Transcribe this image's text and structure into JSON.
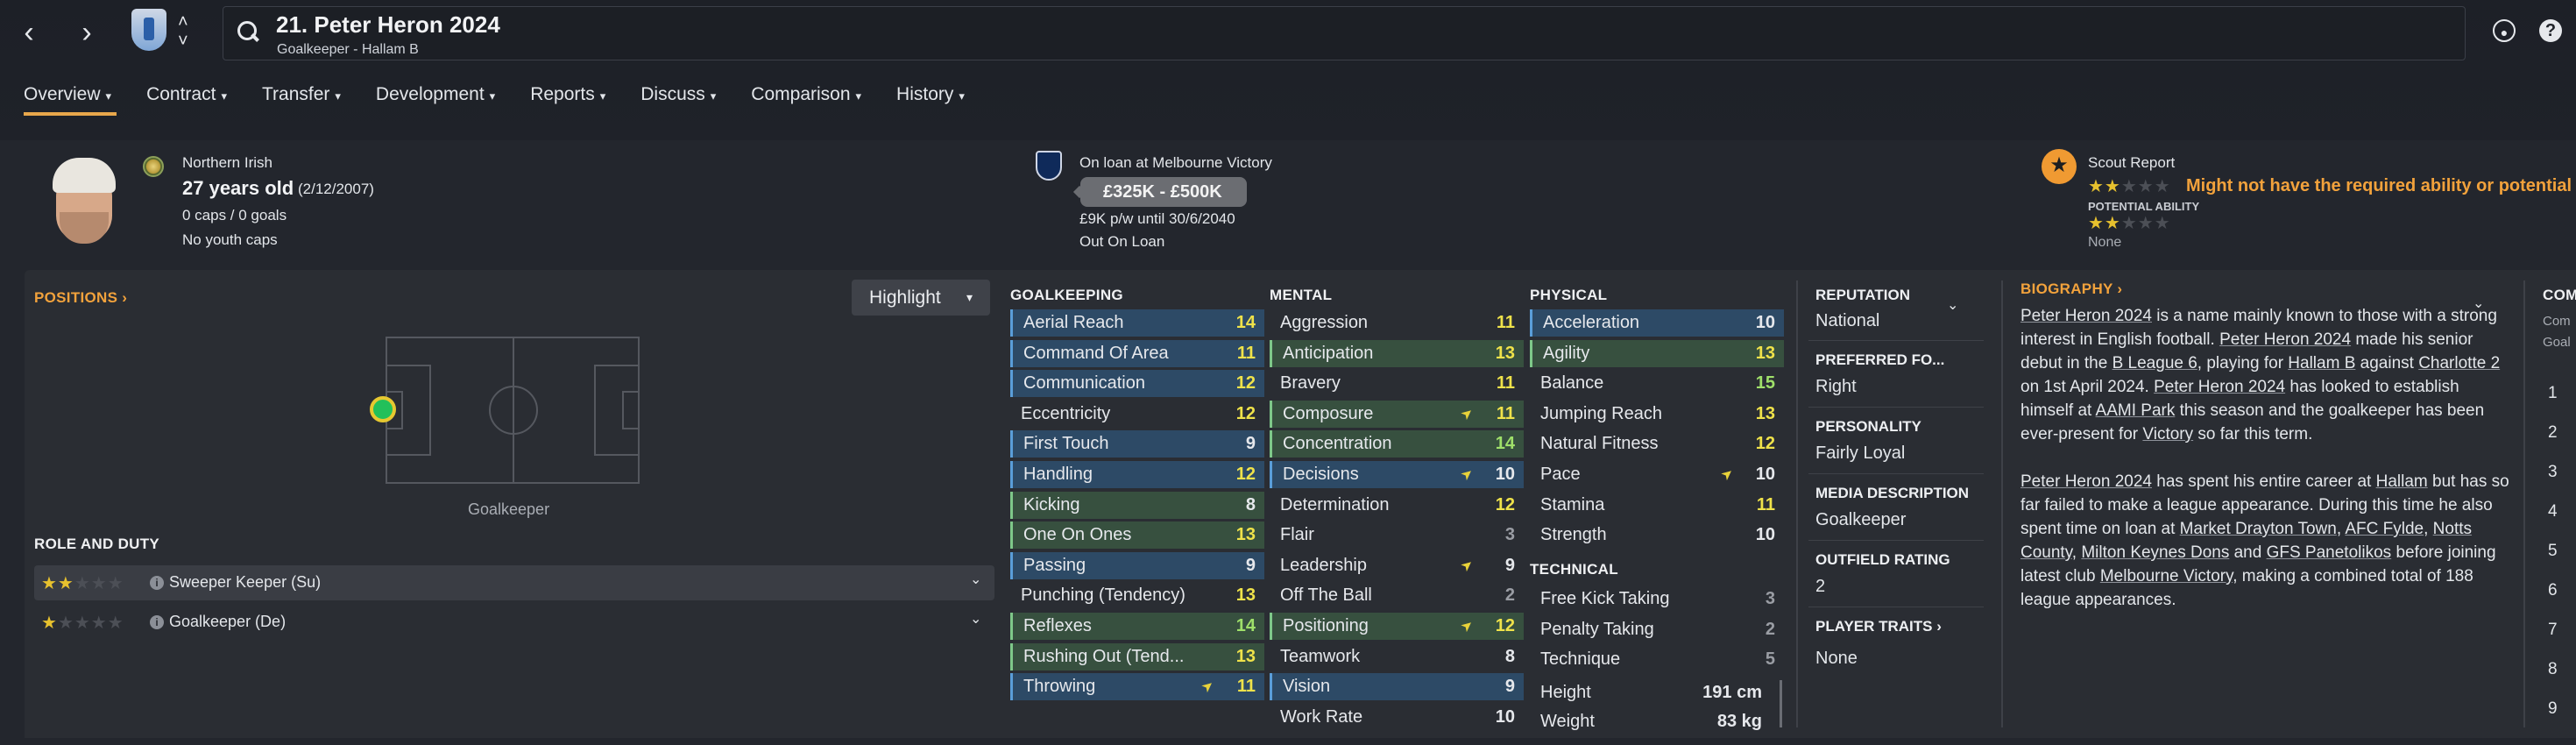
{
  "header": {
    "player_title": "21. Peter Heron 2024",
    "player_subtitle": "Goalkeeper - Hallam B"
  },
  "tabs": [
    {
      "label": "Overview"
    },
    {
      "label": "Contract"
    },
    {
      "label": "Transfer"
    },
    {
      "label": "Development"
    },
    {
      "label": "Reports"
    },
    {
      "label": "Discuss"
    },
    {
      "label": "Comparison"
    },
    {
      "label": "History"
    }
  ],
  "profile": {
    "nationality": "Northern Irish",
    "age": "27 years old",
    "dob": "(2/12/2007)",
    "caps": "0 caps / 0 goals",
    "youth_caps": "No youth caps"
  },
  "loan": {
    "club": "On loan at Melbourne Victory",
    "value": "£325K - £500K",
    "wage": "£9K p/w until 30/6/2040",
    "status": "Out On Loan"
  },
  "scout": {
    "title": "Scout Report",
    "warning": "Might not have the required ability or potential",
    "potential_label": "POTENTIAL ABILITY",
    "potential_value": "None",
    "current_stars": 2,
    "potential_stars": 2
  },
  "positions": {
    "title": "POSITIONS",
    "highlight_label": "Highlight",
    "position_label": "Goalkeeper"
  },
  "role_and_duty": {
    "title": "ROLE AND DUTY",
    "roles": [
      {
        "label": "Sweeper Keeper (Su)",
        "stars": 2
      },
      {
        "label": "Goalkeeper (De)",
        "stars": 1.5
      }
    ]
  },
  "goalkeeping": {
    "title": "GOALKEEPING",
    "rows": [
      {
        "name": "Aerial Reach",
        "value": "14"
      },
      {
        "name": "Command Of Area",
        "value": "11"
      },
      {
        "name": "Communication",
        "value": "12"
      },
      {
        "name": "Eccentricity",
        "value": "12"
      },
      {
        "name": "First Touch",
        "value": "9"
      },
      {
        "name": "Handling",
        "value": "12"
      },
      {
        "name": "Kicking",
        "value": "8"
      },
      {
        "name": "One On Ones",
        "value": "13"
      },
      {
        "name": "Passing",
        "value": "9"
      },
      {
        "name": "Punching (Tendency)",
        "value": "13"
      },
      {
        "name": "Reflexes",
        "value": "14"
      },
      {
        "name": "Rushing Out (Tend...",
        "value": "13"
      },
      {
        "name": "Throwing",
        "value": "11"
      }
    ]
  },
  "mental": {
    "title": "MENTAL",
    "rows": [
      {
        "name": "Aggression",
        "value": "11"
      },
      {
        "name": "Anticipation",
        "value": "13"
      },
      {
        "name": "Bravery",
        "value": "11"
      },
      {
        "name": "Composure",
        "value": "11"
      },
      {
        "name": "Concentration",
        "value": "14"
      },
      {
        "name": "Decisions",
        "value": "10"
      },
      {
        "name": "Determination",
        "value": "12"
      },
      {
        "name": "Flair",
        "value": "3"
      },
      {
        "name": "Leadership",
        "value": "9"
      },
      {
        "name": "Off The Ball",
        "value": "2"
      },
      {
        "name": "Positioning",
        "value": "12"
      },
      {
        "name": "Teamwork",
        "value": "8"
      },
      {
        "name": "Vision",
        "value": "9"
      },
      {
        "name": "Work Rate",
        "value": "10"
      }
    ]
  },
  "physical": {
    "title": "PHYSICAL",
    "rows": [
      {
        "name": "Acceleration",
        "value": "10"
      },
      {
        "name": "Agility",
        "value": "13"
      },
      {
        "name": "Balance",
        "value": "15"
      },
      {
        "name": "Jumping Reach",
        "value": "13"
      },
      {
        "name": "Natural Fitness",
        "value": "12"
      },
      {
        "name": "Pace",
        "value": "10"
      },
      {
        "name": "Stamina",
        "value": "11"
      },
      {
        "name": "Strength",
        "value": "10"
      }
    ]
  },
  "technical": {
    "title": "TECHNICAL",
    "rows": [
      {
        "name": "Free Kick Taking",
        "value": "3"
      },
      {
        "name": "Penalty Taking",
        "value": "2"
      },
      {
        "name": "Technique",
        "value": "5"
      }
    ]
  },
  "measurements": {
    "height_label": "Height",
    "height_value": "191 cm",
    "weight_label": "Weight",
    "weight_value": "83 kg"
  },
  "info": {
    "reputation_label": "REPUTATION",
    "reputation_value": "National",
    "preferred_foot_label": "PREFERRED FO...",
    "preferred_foot_value": "Right",
    "personality_label": "PERSONALITY",
    "personality_value": "Fairly Loyal",
    "media_label": "MEDIA DESCRIPTION",
    "media_value": "Goalkeeper",
    "outfield_label": "OUTFIELD RATING",
    "outfield_value": "2",
    "traits_label": "PLAYER TRAITS",
    "traits_value": "None"
  },
  "biography": {
    "title": "BIOGRAPHY",
    "p1_a": "Peter Heron 2024",
    "p1_b": " is a name mainly known to those with a strong interest in English football. ",
    "p1_c": "Peter Heron 2024",
    "p1_d": " made his senior debut in the ",
    "p1_e": "B League 6",
    "p1_f": ", playing for ",
    "p1_g": "Hallam B",
    "p1_h": " against ",
    "p1_i": "Charlotte 2",
    "p1_j": " on 1st April 2024. ",
    "p1_k": "Peter Heron 2024",
    "p1_l": " has looked to establish himself at ",
    "p1_m": "AAMI Park",
    "p1_n": " this season and the goalkeeper has been ever-present for ",
    "p1_o": "Victory",
    "p1_p": " so far this term.",
    "p2_a": "Peter Heron 2024",
    "p2_b": " has spent his entire career at ",
    "p2_c": "Hallam",
    "p2_d": " but has so far failed to make a league appearance. During this time he also spent time on loan at ",
    "p2_e": "Market Drayton Town",
    "p2_f": ", ",
    "p2_g": "AFC Fylde",
    "p2_h": ", ",
    "p2_i": "Notts County",
    "p2_j": ", ",
    "p2_k": "Milton Keynes Dons",
    "p2_l": " and ",
    "p2_m": "GFS Panetolikos",
    "p2_n": " before joining latest club ",
    "p2_o": "Melbourne Victory",
    "p2_p": ", making a combined total of 188 league appearances."
  },
  "comparison_partial": {
    "title": "COM",
    "sub1": "Com",
    "sub2": "Goal",
    "numbers": [
      "1",
      "2",
      "3",
      "4",
      "5",
      "6",
      "7",
      "8",
      "9"
    ]
  },
  "colors": {
    "accent": "#e8a74b",
    "value_yellow": "#efe24a",
    "value_green": "#9fe06a",
    "highlight_blue": "#2d4a66",
    "highlight_green": "#37503f",
    "warning_orange": "#f2a23c"
  }
}
